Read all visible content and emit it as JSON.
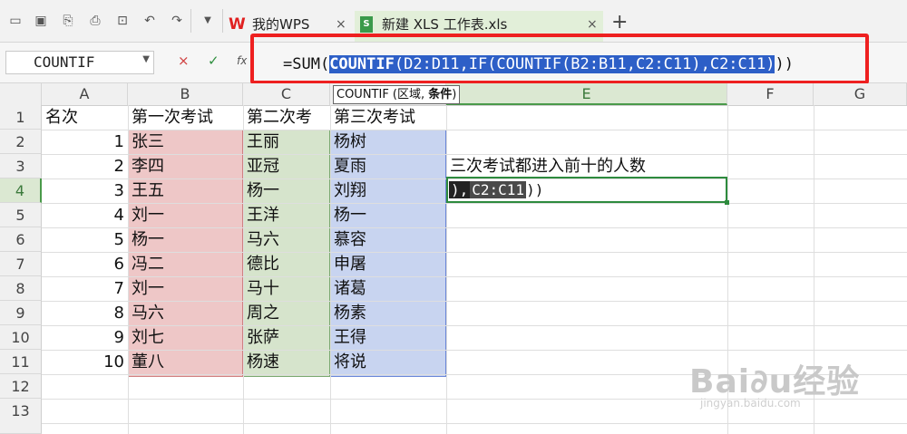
{
  "tabs": {
    "wps": {
      "label": "我的WPS",
      "close": "×"
    },
    "xls": {
      "label": "新建 XLS 工作表.xls",
      "close": "×"
    },
    "new": "+"
  },
  "formula_bar": {
    "name_box": "COUNTIF",
    "cancel": "×",
    "confirm": "✓",
    "fx": "fx",
    "formula_prefix": "=SUM(",
    "formula_selected_fn": "COUNTIF",
    "formula_selected_rest": "(D2:D11,IF(COUNTIF(B2:B11,C2:C11),C2:C11)",
    "formula_suffix": "))"
  },
  "tooltip": {
    "text": "COUNTIF (区域, ",
    "bold": "条件",
    "close": ")"
  },
  "columns": [
    "A",
    "B",
    "C",
    "D",
    "E",
    "F",
    "G"
  ],
  "rows": [
    "1",
    "2",
    "3",
    "4",
    "5",
    "6",
    "7",
    "8",
    "9",
    "10",
    "11",
    "12",
    "13"
  ],
  "sheet": {
    "header_name": "名次",
    "header_b": "第一次考试",
    "header_c": "第二次考",
    "header_d": "第三次考试",
    "ranks": [
      "1",
      "2",
      "3",
      "4",
      "5",
      "6",
      "7",
      "8",
      "9",
      "10"
    ],
    "col_b": [
      "张三",
      "李四",
      "王五",
      "刘一",
      "杨一",
      "冯二",
      "刘一",
      "马六",
      "刘七",
      "董八"
    ],
    "col_c": [
      "王丽",
      "亚冠",
      "杨一",
      "王洋",
      "马六",
      "德比",
      "马十",
      "周之",
      "张萨",
      "杨速"
    ],
    "col_d": [
      "杨树",
      "夏雨",
      "刘翔",
      "杨一",
      "慕容",
      "申屠",
      "诸葛",
      "杨素",
      "王得",
      "将说"
    ],
    "e3": "三次考试都进入前十的人数",
    "e4_part1": "),",
    "e4_part2": "C2:C11",
    "e4_part3": "))"
  },
  "colors": {
    "band_b": "#eec7c7",
    "band_c": "#d6e4cc",
    "band_d": "#c8d4f0",
    "highlight_box": "#ee2020",
    "active_cell": "#2e8b3e"
  },
  "watermark": {
    "brand": "Bai∂u经验",
    "url": "jingyan.baidu.com"
  }
}
